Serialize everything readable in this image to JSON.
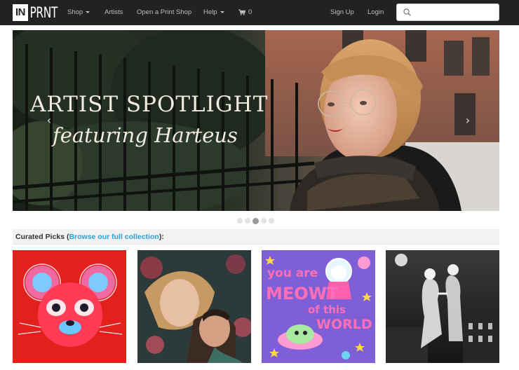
{
  "nav": {
    "logo_in": "IN",
    "logo_prnt": "PRNT",
    "shop": "Shop",
    "artists": "Artists",
    "open_shop": "Open a Print Shop",
    "help": "Help",
    "cart_count": "0",
    "signup": "Sign Up",
    "login": "Login",
    "search_placeholder": ""
  },
  "hero": {
    "title": "ARTIST SPOTLIGHT",
    "subtitle": "featuring Harteus",
    "prev_arrow": "‹",
    "next_arrow": "›",
    "slide_count": 5,
    "active_slide": 3
  },
  "curated": {
    "prefix": "Curated Picks (",
    "link": "Browse our full collection",
    "suffix": "):"
  },
  "tiles": {
    "meowt": {
      "line1": "you are",
      "line2": "MEOWT",
      "line3": "of this",
      "line4": "WORLD"
    }
  },
  "colors": {
    "navbar": "#222222",
    "link": "#2a9fd6",
    "nav_text": "#bfbfbf"
  },
  "icons": [
    "cart-icon",
    "search-icon",
    "caret-down-icon",
    "chevron-left-icon",
    "chevron-right-icon"
  ]
}
